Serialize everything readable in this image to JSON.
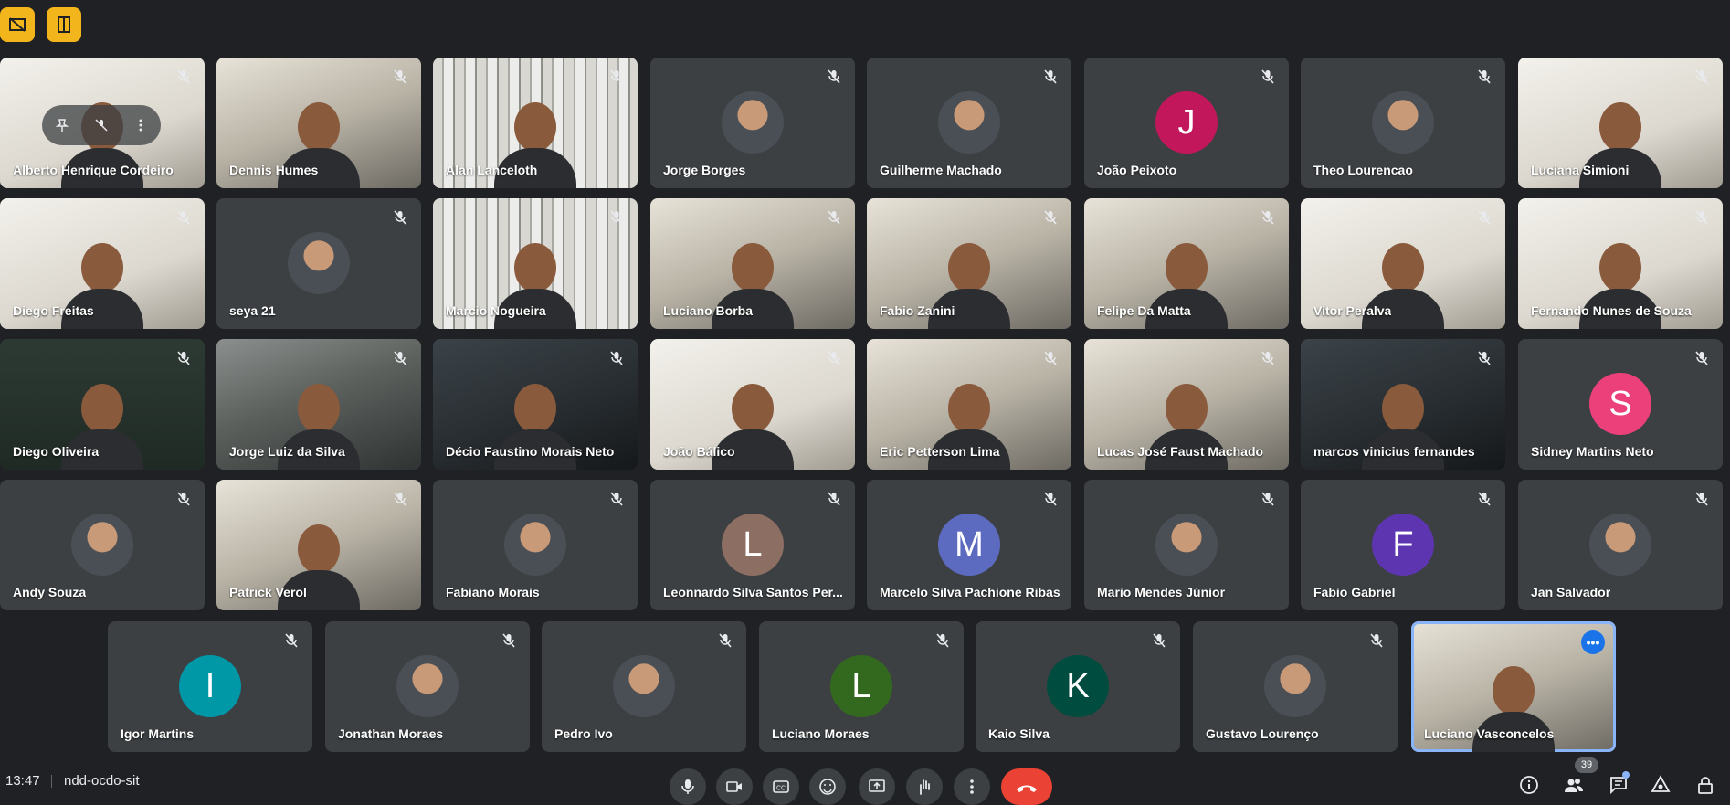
{
  "top_buttons": [
    {
      "icon": "hide-self-view-icon"
    },
    {
      "icon": "door-exit-icon"
    }
  ],
  "colors": {
    "accent": "#f2b61c",
    "end_call": "#ea4335",
    "tile": "#3c4043",
    "background": "#202124",
    "active_border": "#8ab4f8"
  },
  "participants": [
    {
      "name": "Alberto Henrique Cordeiro",
      "kind": "video",
      "style": "bright",
      "pin_overlay": true
    },
    {
      "name": "Dennis Humes",
      "kind": "video",
      "style": "light"
    },
    {
      "name": "Alan Lanceloth",
      "kind": "video",
      "style": "books"
    },
    {
      "name": "Jorge Borges",
      "kind": "photo"
    },
    {
      "name": "Guilherme Machado",
      "kind": "photo"
    },
    {
      "name": "João Peixoto",
      "kind": "letter",
      "letter": "J",
      "color": "#c2185b"
    },
    {
      "name": "Theo Lourencao",
      "kind": "photo"
    },
    {
      "name": "Luciana Simioni",
      "kind": "video",
      "style": "bright"
    },
    {
      "name": "Diego Freitas",
      "kind": "video",
      "style": "bright"
    },
    {
      "name": "seya 21",
      "kind": "photo"
    },
    {
      "name": "Marcio Nogueira",
      "kind": "video",
      "style": "books"
    },
    {
      "name": "Luciano Borba",
      "kind": "video",
      "style": "light"
    },
    {
      "name": "Fabio Zanini",
      "kind": "video",
      "style": "light"
    },
    {
      "name": "Felipe Da Matta",
      "kind": "video",
      "style": "light"
    },
    {
      "name": "Vitor Peralva",
      "kind": "video",
      "style": "bright"
    },
    {
      "name": "Fernando Nunes de Souza",
      "kind": "video",
      "style": "bright"
    },
    {
      "name": "Diego Oliveira",
      "kind": "video",
      "style": "green"
    },
    {
      "name": "Jorge Luiz da Silva",
      "kind": "video",
      "style": "video"
    },
    {
      "name": "Décio Faustino Morais Neto",
      "kind": "video",
      "style": "dark"
    },
    {
      "name": "João Bálico",
      "kind": "video",
      "style": "bright"
    },
    {
      "name": "Eric Petterson Lima",
      "kind": "video",
      "style": "light"
    },
    {
      "name": "Lucas José Faust Machado",
      "kind": "video",
      "style": "light"
    },
    {
      "name": "marcos vinicius fernandes",
      "kind": "video",
      "style": "dark"
    },
    {
      "name": "Sidney Martins Neto",
      "kind": "letter",
      "letter": "S",
      "color": "#ec407a"
    },
    {
      "name": "Andy Souza",
      "kind": "photo"
    },
    {
      "name": "Patrick Verol",
      "kind": "video",
      "style": "light"
    },
    {
      "name": "Fabiano Morais",
      "kind": "photo"
    },
    {
      "name": "Leonnardo Silva Santos Per...",
      "kind": "letter",
      "letter": "L",
      "color": "#8d6e63"
    },
    {
      "name": "Marcelo Silva Pachione Ribas",
      "kind": "letter",
      "letter": "M",
      "color": "#5c6bc0"
    },
    {
      "name": "Mario Mendes Júnior",
      "kind": "photo"
    },
    {
      "name": "Fabio Gabriel",
      "kind": "letter",
      "letter": "F",
      "color": "#5e35b1"
    },
    {
      "name": "Jan Salvador",
      "kind": "photo"
    },
    {
      "name": "Igor Martins",
      "kind": "letter",
      "letter": "I",
      "color": "#0097a7"
    },
    {
      "name": "Jonathan Moraes",
      "kind": "photo"
    },
    {
      "name": "Pedro Ivo",
      "kind": "photo"
    },
    {
      "name": "Luciano Moraes",
      "kind": "letter",
      "letter": "L",
      "color": "#33691e"
    },
    {
      "name": "Kaio Silva",
      "kind": "letter",
      "letter": "K",
      "color": "#004d40"
    },
    {
      "name": "Gustavo Lourenço",
      "kind": "photo"
    },
    {
      "name": "Luciano Vasconcelos",
      "kind": "video",
      "style": "light",
      "active": true,
      "more_button": true
    }
  ],
  "bottom_bar": {
    "time": "13:47",
    "meeting_code": "ndd-ocdo-sit",
    "participant_count": "39",
    "controls": [
      {
        "icon": "microphone-icon"
      },
      {
        "icon": "camera-icon"
      },
      {
        "icon": "captions-icon"
      },
      {
        "icon": "emoji-icon"
      },
      {
        "icon": "present-screen-icon"
      },
      {
        "icon": "raise-hand-icon"
      },
      {
        "icon": "more-options-icon"
      },
      {
        "icon": "end-call-icon"
      }
    ],
    "right_icons": [
      {
        "icon": "info-icon"
      },
      {
        "icon": "people-icon"
      },
      {
        "icon": "chat-icon"
      },
      {
        "icon": "activities-icon"
      },
      {
        "icon": "lock-icon"
      }
    ]
  }
}
